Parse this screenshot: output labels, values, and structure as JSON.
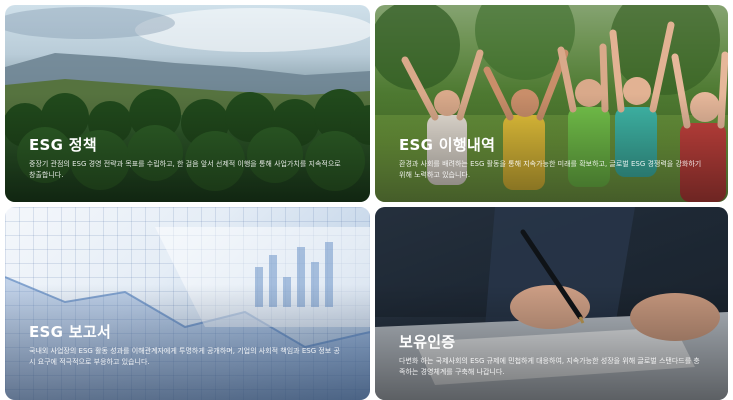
{
  "cards": [
    {
      "title": "ESG 정책",
      "description": "중장기 관점의 ESG 경영 전략과 목표를 수립하고, 한 걸음 앞서 선제적 이행을 통해 사업가치를 지속적으로 창출합니다."
    },
    {
      "title": "ESG 이행내역",
      "description": "환경과 사회를 배려하는 ESG 활동을 통해 지속가능한 미래를 확보하고, 글로벌 ESG 경쟁력을 강화하기 위해 노력하고 있습니다."
    },
    {
      "title": "ESG 보고서",
      "description": "국내외 사업장의 ESG 활동 성과를 이해관계자에게 투명하게 공개하며, 기업의 사회적 책임과 ESG 정보 공시 요구에 적극적으로 부응하고 있습니다."
    },
    {
      "title": "보유인증",
      "description": "다변화 하는 국제사회의 ESG 규제에 민첩하게 대응하여, 지속가능한 성장을 위해 글로벌 스탠다드를 충족하는 경영체계를 구축해 나갑니다."
    }
  ]
}
